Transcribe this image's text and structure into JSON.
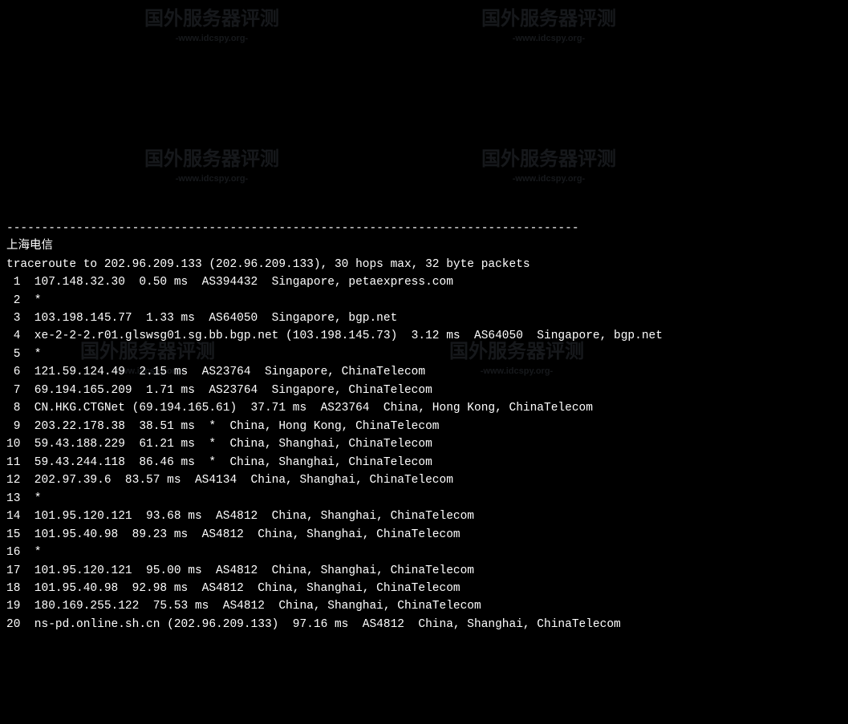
{
  "separator": "----------------------------------------------------------------------------------",
  "header_label": "上海电信",
  "traceroute_header": "traceroute to 202.96.209.133 (202.96.209.133), 30 hops max, 32 byte packets",
  "watermark_main": "国外服务器评测",
  "watermark_sub": "-www.idcspy.org-",
  "hops": [
    {
      "line": " 1  107.148.32.30  0.50 ms  AS394432  Singapore, petaexpress.com"
    },
    {
      "line": " 2  *"
    },
    {
      "line": " 3  103.198.145.77  1.33 ms  AS64050  Singapore, bgp.net"
    },
    {
      "line": " 4  xe-2-2-2.r01.glswsg01.sg.bb.bgp.net (103.198.145.73)  3.12 ms  AS64050  Singapore, bgp.net"
    },
    {
      "line": " 5  *"
    },
    {
      "line": " 6  121.59.124.49  2.15 ms  AS23764  Singapore, ChinaTelecom"
    },
    {
      "line": " 7  69.194.165.209  1.71 ms  AS23764  Singapore, ChinaTelecom"
    },
    {
      "line": " 8  CN.HKG.CTGNet (69.194.165.61)  37.71 ms  AS23764  China, Hong Kong, ChinaTelecom"
    },
    {
      "line": " 9  203.22.178.38  38.51 ms  *  China, Hong Kong, ChinaTelecom"
    },
    {
      "line": "10  59.43.188.229  61.21 ms  *  China, Shanghai, ChinaTelecom"
    },
    {
      "line": "11  59.43.244.118  86.46 ms  *  China, Shanghai, ChinaTelecom"
    },
    {
      "line": "12  202.97.39.6  83.57 ms  AS4134  China, Shanghai, ChinaTelecom"
    },
    {
      "line": "13  *"
    },
    {
      "line": "14  101.95.120.121  93.68 ms  AS4812  China, Shanghai, ChinaTelecom"
    },
    {
      "line": "15  101.95.40.98  89.23 ms  AS4812  China, Shanghai, ChinaTelecom"
    },
    {
      "line": "16  *"
    },
    {
      "line": "17  101.95.120.121  95.00 ms  AS4812  China, Shanghai, ChinaTelecom"
    },
    {
      "line": "18  101.95.40.98  92.98 ms  AS4812  China, Shanghai, ChinaTelecom"
    },
    {
      "line": "19  180.169.255.122  75.53 ms  AS4812  China, Shanghai, ChinaTelecom"
    },
    {
      "line": "20  ns-pd.online.sh.cn (202.96.209.133)  97.16 ms  AS4812  China, Shanghai, ChinaTelecom"
    }
  ]
}
